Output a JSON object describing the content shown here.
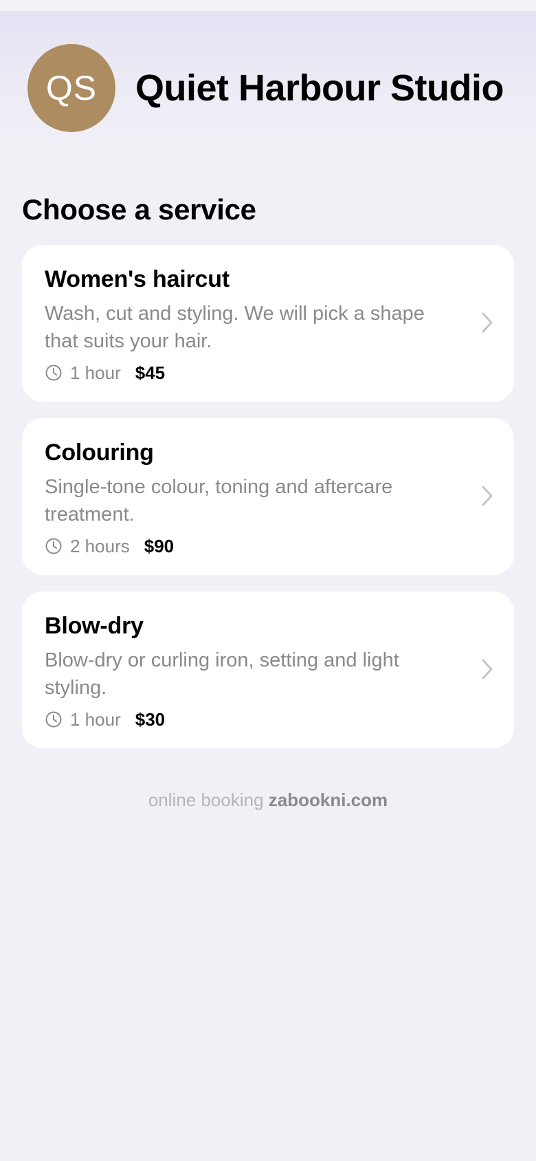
{
  "header": {
    "avatar_initials": "QS",
    "avatar_color": "#ad8c61",
    "studio_name": "Quiet Harbour Studio"
  },
  "section_title": "Choose a service",
  "services": [
    {
      "title": "Women's haircut",
      "description": "Wash, cut and styling. We will pick a shape that suits your hair.",
      "duration": "1 hour",
      "price": "$45"
    },
    {
      "title": "Colouring",
      "description": "Single-tone colour, toning and aftercare treatment.",
      "duration": "2 hours",
      "price": "$90"
    },
    {
      "title": "Blow-dry",
      "description": "Blow-dry or curling iron, setting and light styling.",
      "duration": "1 hour",
      "price": "$30"
    }
  ],
  "icons": {
    "duration": "clock-icon",
    "open": "chevron-right-icon"
  },
  "footer": {
    "label": "online booking",
    "link": "zabookni.com"
  },
  "colors": {
    "background": "#f1f0f6",
    "card": "#ffffff",
    "secondary_text": "#8a8a8e",
    "muted_text": "#b5b5ba"
  }
}
